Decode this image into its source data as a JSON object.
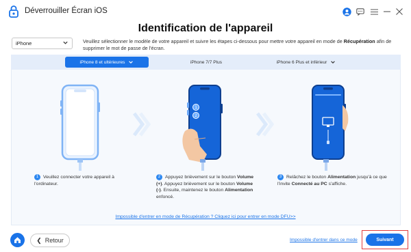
{
  "window": {
    "title": "Déverrouiller Écran iOS"
  },
  "page": {
    "title": "Identification de l'appareil"
  },
  "model_select": {
    "value": "iPhone"
  },
  "instruction": {
    "part1": "Veuillez sélectionner le modèle de votre appareil et suivre les étapes ci-dessous pour mettre votre appareil en mode de ",
    "bold": "Récupération",
    "part2": " afin de supprimer le mot de passe de l'écran."
  },
  "tabs": [
    {
      "label": "iPhone 8 et ultérieures",
      "active": true
    },
    {
      "label": "iPhone 7/7 Plus",
      "active": false
    },
    {
      "label": "iPhone 6 Plus et inférieur",
      "active": false
    }
  ],
  "steps": [
    {
      "num": "1",
      "text1": "Veuillez connecter votre appareil à l'ordinateur.",
      "bold1": "",
      "text2": "",
      "bold2": "",
      "text3": "",
      "bold3": "",
      "text4": ""
    },
    {
      "num": "2",
      "text1": "Appuyez brièvement sur le bouton ",
      "bold1": "Volume (+)",
      "text2": ". Appuyez brièvement sur le bouton ",
      "bold2": "Volume (-)",
      "text3": ". Ensuite, maintenez le bouton ",
      "bold3": "Alimentation",
      "text4": " enfoncé."
    },
    {
      "num": "3",
      "text1": "Relâchez le bouton ",
      "bold1": "Alimentation",
      "text2": " jusqu'à ce que l'invite ",
      "bold2": "Connecté au PC",
      "text3": " s'affiche.",
      "bold3": "",
      "text4": ""
    }
  ],
  "phone_markers": [
    "1",
    "2"
  ],
  "dfu_link": "Impossible d'entrer en mode de Récupération ? Cliquez ici pour entrer en mode DFU>>",
  "bottom": {
    "back_label": "Retour",
    "dfu_bottom_link": "Impossible d'entrer dans ce mode",
    "next_label": "Suivant"
  },
  "colors": {
    "accent": "#1a73e8",
    "highlight": "#e23b3b",
    "phone_screen": "#1565d8"
  }
}
